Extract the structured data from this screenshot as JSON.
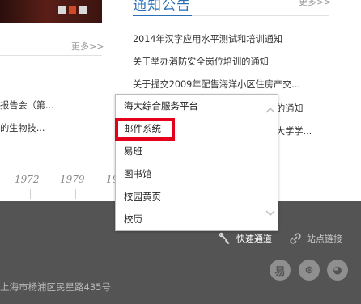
{
  "slider": {
    "dots": [
      "slide-1",
      "slide-2",
      "slide-3"
    ],
    "active_index": 1
  },
  "notices": {
    "title": "通知公告",
    "more_label": "更多>>",
    "items": [
      "2014年汉字应用水平测试和培训通知",
      "关于举办消防安全岗位培训的通知",
      "关于提交2009年配售海洋小区住房产交...",
      "的通知",
      "大学学..."
    ]
  },
  "news": {
    "more_label": "更多>>",
    "items": [
      "报告会（第...",
      "的生物技..."
    ]
  },
  "timeline": {
    "years": [
      "1972",
      "1979",
      "19"
    ]
  },
  "footer": {
    "quick_access_label": "快速通道",
    "site_links_label": "站点链接",
    "address": "上海市杨浦区民星路435号",
    "social": [
      {
        "name": "yiban",
        "glyph": "易"
      },
      {
        "name": "weibo",
        "glyph": "⊛"
      },
      {
        "name": "wechat",
        "glyph": "◕"
      }
    ]
  },
  "quick_menu": {
    "items": [
      "海大综合服务平台",
      "邮件系统",
      "易班",
      "图书馆",
      "校园黄页",
      "校历"
    ],
    "highlighted_index": 1
  },
  "colors": {
    "accent_blue": "#2a6fb8",
    "footer_bg": "#545454",
    "highlight_red": "#e4001b",
    "slider_active": "#d2492a"
  }
}
